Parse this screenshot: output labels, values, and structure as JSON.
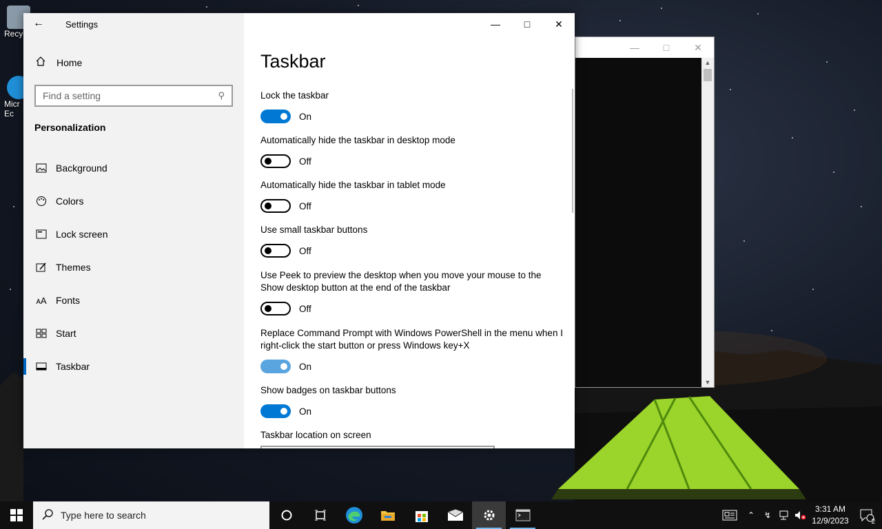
{
  "desktop": {
    "icons": [
      {
        "label": "Recyc",
        "icon": "recycle-bin-icon"
      },
      {
        "label": "Micr\nEc",
        "icon": "edge-icon"
      }
    ]
  },
  "settings_window": {
    "app_title": "Settings",
    "home_label": "Home",
    "search_placeholder": "Find a setting",
    "section_label": "Personalization",
    "nav": [
      {
        "label": "Background",
        "icon": "picture-icon"
      },
      {
        "label": "Colors",
        "icon": "palette-icon"
      },
      {
        "label": "Lock screen",
        "icon": "lock-screen-icon"
      },
      {
        "label": "Themes",
        "icon": "brush-icon"
      },
      {
        "label": "Fonts",
        "icon": "font-icon"
      },
      {
        "label": "Start",
        "icon": "start-icon"
      },
      {
        "label": "Taskbar",
        "icon": "taskbar-icon",
        "active": true
      }
    ],
    "page_title": "Taskbar",
    "settings": [
      {
        "label": "Lock the taskbar",
        "state": "On",
        "on": true
      },
      {
        "label": "Automatically hide the taskbar in desktop mode",
        "state": "Off",
        "on": false
      },
      {
        "label": "Automatically hide the taskbar in tablet mode",
        "state": "Off",
        "on": false
      },
      {
        "label": "Use small taskbar buttons",
        "state": "Off",
        "on": false
      },
      {
        "label": "Use Peek to preview the desktop when you move your mouse to the Show desktop button at the end of the taskbar",
        "state": "Off",
        "on": false
      },
      {
        "label": "Replace Command Prompt with Windows PowerShell in the menu when I right-click the start button or press Windows key+X",
        "state": "On",
        "on": true
      },
      {
        "label": "Show badges on taskbar buttons",
        "state": "On",
        "on": true
      }
    ],
    "location_label": "Taskbar location on screen"
  },
  "taskbar": {
    "search_placeholder": "Type here to search",
    "apps": [
      "cortana-icon",
      "task-view-icon",
      "edge-icon",
      "file-explorer-icon",
      "store-icon",
      "mail-icon",
      "settings-icon",
      "terminal-icon"
    ],
    "time": "3:31 AM",
    "date": "12/9/2023",
    "notification_count": "2"
  },
  "colors": {
    "accent": "#0078d4",
    "sidebar_bg": "#f2f2f2"
  }
}
